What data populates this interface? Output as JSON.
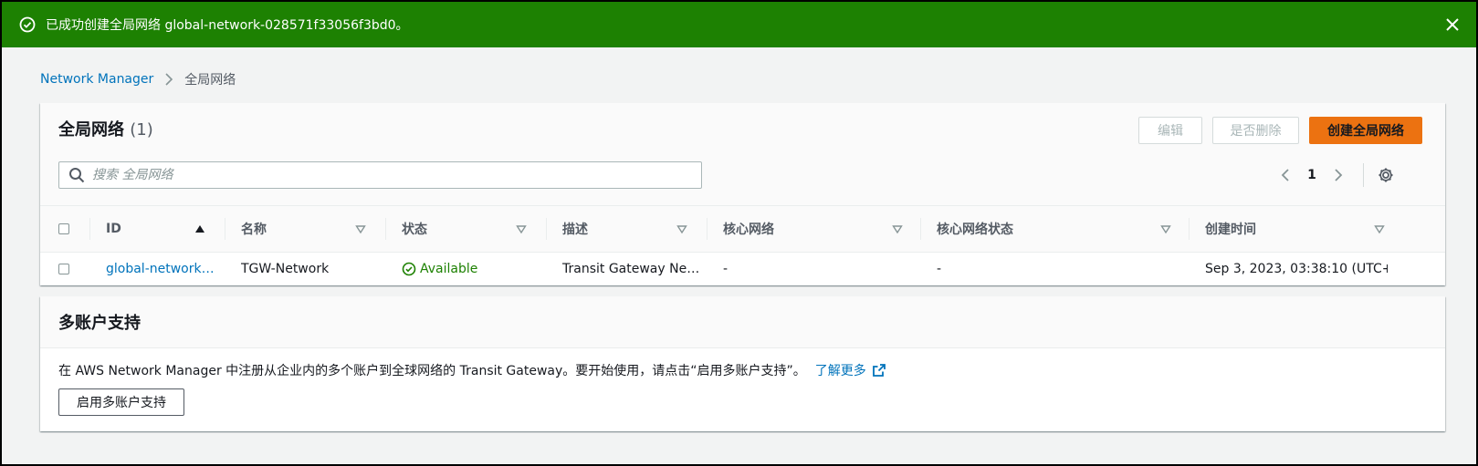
{
  "flash": {
    "message": "已成功创建全局网络 global-network-028571f33056f3bd0。"
  },
  "breadcrumb": {
    "root": "Network Manager",
    "current": "全局网络"
  },
  "panel": {
    "title": "全局网络",
    "count": "(1)",
    "buttons": {
      "edit": "编辑",
      "delete": "是否删除",
      "create": "创建全局网络"
    },
    "search_placeholder": "搜索 全局网络",
    "page": "1",
    "columns": [
      "ID",
      "名称",
      "状态",
      "描述",
      "核心网络",
      "核心网络状态",
      "创建时间"
    ],
    "rows": [
      {
        "id": "global-network…",
        "name": "TGW-Network",
        "status": "Available",
        "description": "Transit Gateway Ne…",
        "core_network": "-",
        "core_network_status": "-",
        "created": "Sep 3, 2023, 03:38:10 (UTC+…"
      }
    ]
  },
  "multi_account": {
    "title": "多账户支持",
    "description": "在 AWS Network Manager 中注册从企业内的多个账户到全球网络的 Transit Gateway。要开始使用，请点击“启用多账户支持”。",
    "learn_more": "了解更多",
    "enable_button": "启用多账户支持"
  },
  "colors": {
    "flash_success": "#1d8102",
    "link": "#0073bb",
    "primary_button": "#ec7211",
    "status_available": "#1d8102"
  }
}
